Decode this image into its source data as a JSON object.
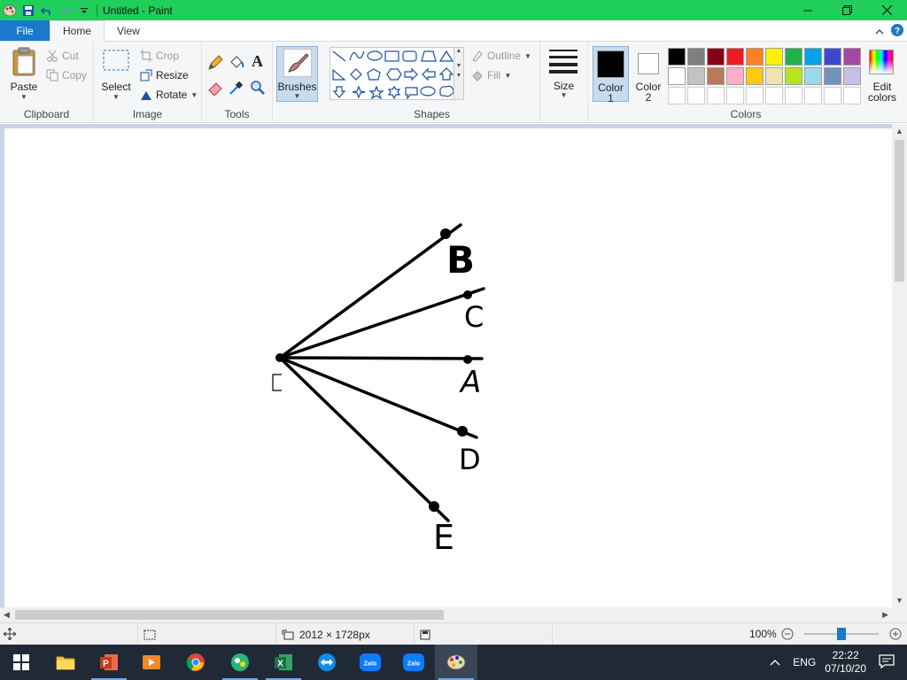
{
  "window": {
    "title": "Untitled - Paint",
    "controls": [
      "minimize",
      "maximize",
      "close"
    ]
  },
  "tabs": {
    "file": "File",
    "home": "Home",
    "view": "View"
  },
  "clipboard": {
    "label": "Clipboard",
    "paste": "Paste",
    "cut": "Cut",
    "copy": "Copy"
  },
  "image": {
    "label": "Image",
    "select": "Select",
    "crop": "Crop",
    "resize": "Resize",
    "rotate": "Rotate"
  },
  "tools": {
    "label": "Tools",
    "brushes": "Brushes"
  },
  "shapes": {
    "label": "Shapes",
    "outline": "Outline",
    "fill": "Fill"
  },
  "size": {
    "label": "Size"
  },
  "colors": {
    "label": "Colors",
    "color1_line1": "Color",
    "color1_line2": "1",
    "color2_line1": "Color",
    "color2_line2": "2",
    "edit_line1": "Edit",
    "edit_line2": "colors",
    "color1": "#000000",
    "color2": "#ffffff",
    "palette_row1": [
      "#000000",
      "#7f7f7f",
      "#880015",
      "#ed1c24",
      "#ff7f27",
      "#fff200",
      "#22b14c",
      "#00a2e8",
      "#3f48cc",
      "#a349a4"
    ],
    "palette_row2": [
      "#ffffff",
      "#c3c3c3",
      "#b97a57",
      "#ffaec9",
      "#ffc90e",
      "#efe4b0",
      "#b5e61d",
      "#99d9ea",
      "#7092be",
      "#c8bfe7"
    ],
    "palette_row3": [
      "#ffffff",
      "#ffffff",
      "#ffffff",
      "#ffffff",
      "#ffffff",
      "#ffffff",
      "#ffffff",
      "#ffffff",
      "#ffffff",
      "#ffffff"
    ]
  },
  "drawing": {
    "labels": {
      "b": "B",
      "c": "C",
      "a": "A",
      "d": "D",
      "e": "E"
    }
  },
  "status": {
    "dimensions": "2012 × 1728px",
    "zoom": "100%",
    "zoom_level": 1.0
  },
  "taskbar": {
    "apps": [
      "start",
      "file-explorer",
      "powerpoint",
      "media-player",
      "chrome",
      "app-green",
      "excel",
      "teamviewer",
      "zalo",
      "zalo",
      "paint"
    ],
    "zalo_label": "Zalo",
    "language": "ENG",
    "time": "22:22",
    "date": "07/10/20"
  }
}
